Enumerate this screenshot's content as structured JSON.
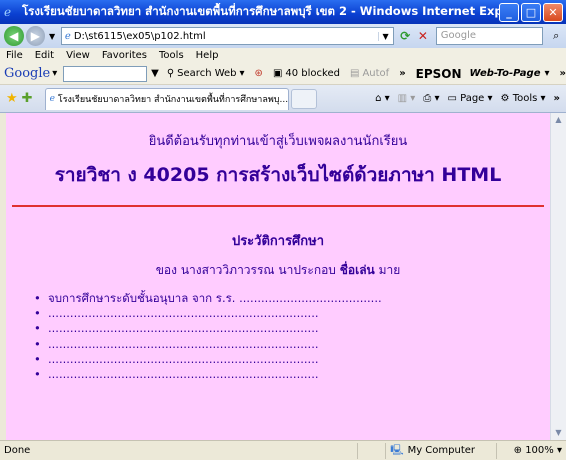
{
  "window": {
    "title": "โรงเรียนชัยบาดาลวิทยา สำนักงานเขตพื้นที่การศึกษาลพบุรี เขต 2 - Windows Internet Explorer",
    "buttons": {
      "minimize": "_",
      "maximize": "□",
      "close": "✕"
    }
  },
  "address_bar": {
    "url": "D:\\st6115\\ex05\\p102.html",
    "search_placeholder": "Google"
  },
  "menu": [
    "File",
    "Edit",
    "View",
    "Favorites",
    "Tools",
    "Help"
  ],
  "google_toolbar": {
    "brand": "Google",
    "search_web": "Search Web",
    "blocked": "40 blocked",
    "autofill": "Autof",
    "overflow": "»",
    "epson": "EPSON",
    "web_to_page": "Web-To-Page",
    "overflow2": "»"
  },
  "tabs": {
    "active_title": "โรงเรียนชัยบาดาลวิทยา สำนักงานเขตพื้นที่การศึกษาลพบุ...",
    "page_menu": "Page",
    "tools_menu": "Tools",
    "overflow": "»"
  },
  "page": {
    "welcome": "ยินดีต้อนรับทุกท่านเข้าสู่เว็บเพจผลงานนักเรียน",
    "subject": "รายวิชา ง 40205 การสร้างเว็บไซต์ด้วยภาษา HTML",
    "section_title": "ประวัติการศึกษา",
    "owner_prefix": "ของ",
    "owner_name": "นางสาววิภาวรรณ นาประกอบ",
    "nickname_label": "ชื่อเล่น",
    "nickname": "มาย",
    "education_items": [
      "จบการศึกษาระดับชั้นอนุบาล จาก ร.ร. .......................................",
      "..........................................................................",
      "..........................................................................",
      "..........................................................................",
      "..........................................................................",
      ".........................................................................."
    ]
  },
  "status": {
    "text": "Done",
    "zone": "My Computer",
    "zoom": "100%"
  },
  "colors": {
    "page_background": "#ffccff",
    "heading_text": "#330099",
    "divider": "#e03030"
  }
}
